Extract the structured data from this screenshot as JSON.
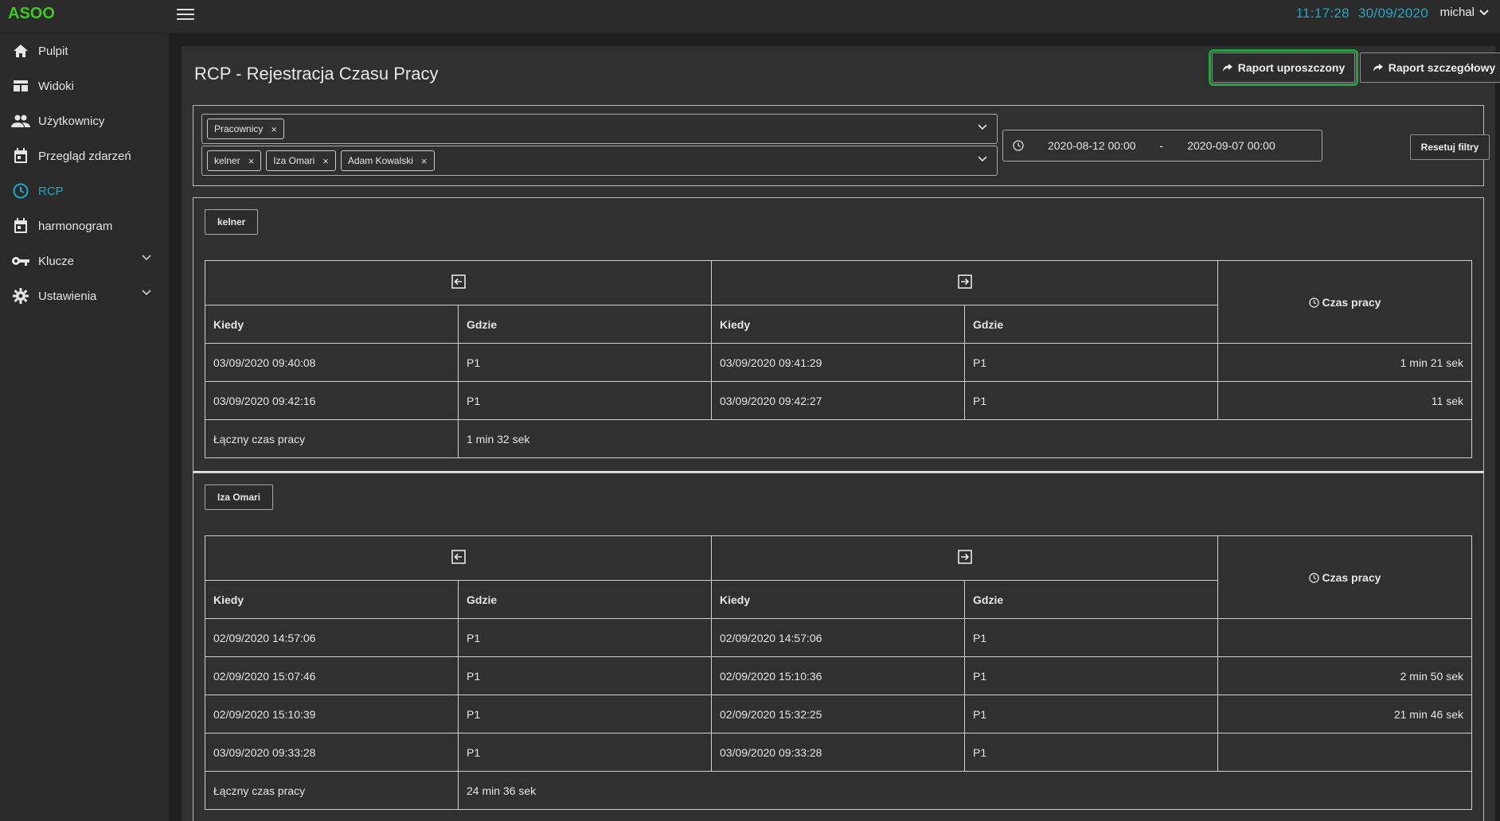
{
  "app": {
    "logo": "ASOO",
    "time": "11:17:28",
    "date": "30/09/2020",
    "user": "michal"
  },
  "colors": {
    "accent": "#1ba9c6",
    "logo": "#3ecb1f",
    "highlight": "#25a244"
  },
  "sidebar": {
    "items": [
      {
        "label": "Pulpit",
        "icon": "home-icon"
      },
      {
        "label": "Widoki",
        "icon": "grid-icon"
      },
      {
        "label": "Użytkownicy",
        "icon": "users-icon"
      },
      {
        "label": "Przegląd zdarzeń",
        "icon": "calendar-icon"
      },
      {
        "label": "RCP",
        "icon": "clock-icon",
        "active": true
      },
      {
        "label": "harmonogram",
        "icon": "calendar-icon"
      },
      {
        "label": "Klucze",
        "icon": "key-icon",
        "expandable": true
      },
      {
        "label": "Ustawienia",
        "icon": "gear-icon",
        "expandable": true
      }
    ]
  },
  "page": {
    "title": "RCP - Rejestracja Czasu Pracy",
    "btn_simple": "Raport uproszczony",
    "btn_detailed": "Raport szczegółowy"
  },
  "filters": {
    "group_chip": "Pracownicy",
    "people_chips": [
      "kelner",
      "Iza Omari",
      "Adam Kowalski"
    ],
    "date_from": "2020-08-12 00:00",
    "date_sep": "-",
    "date_to": "2020-09-07 00:00",
    "reset": "Resetuj filtry"
  },
  "table_headers": {
    "when": "Kiedy",
    "where": "Gdzie",
    "work_time": "Czas pracy",
    "total_label": "Łączny czas pracy"
  },
  "sections": [
    {
      "name": "kelner",
      "rows": [
        {
          "in_when": "03/09/2020 09:40:08",
          "in_where": "P1",
          "out_when": "03/09/2020 09:41:29",
          "out_where": "P1",
          "time": "1 min 21 sek"
        },
        {
          "in_when": "03/09/2020 09:42:16",
          "in_where": "P1",
          "out_when": "03/09/2020 09:42:27",
          "out_where": "P1",
          "time": "11 sek"
        }
      ],
      "total": "1 min 32 sek"
    },
    {
      "name": "Iza Omari",
      "rows": [
        {
          "in_when": "02/09/2020 14:57:06",
          "in_where": "P1",
          "out_when": "02/09/2020 14:57:06",
          "out_where": "P1",
          "time": ""
        },
        {
          "in_when": "02/09/2020 15:07:46",
          "in_where": "P1",
          "out_when": "02/09/2020 15:10:36",
          "out_where": "P1",
          "time": "2 min 50 sek"
        },
        {
          "in_when": "02/09/2020 15:10:39",
          "in_where": "P1",
          "out_when": "02/09/2020 15:32:25",
          "out_where": "P1",
          "time": "21 min 46 sek"
        },
        {
          "in_when": "03/09/2020 09:33:28",
          "in_where": "P1",
          "out_when": "03/09/2020 09:33:28",
          "out_where": "P1",
          "time": ""
        }
      ],
      "total": "24 min 36 sek"
    }
  ]
}
